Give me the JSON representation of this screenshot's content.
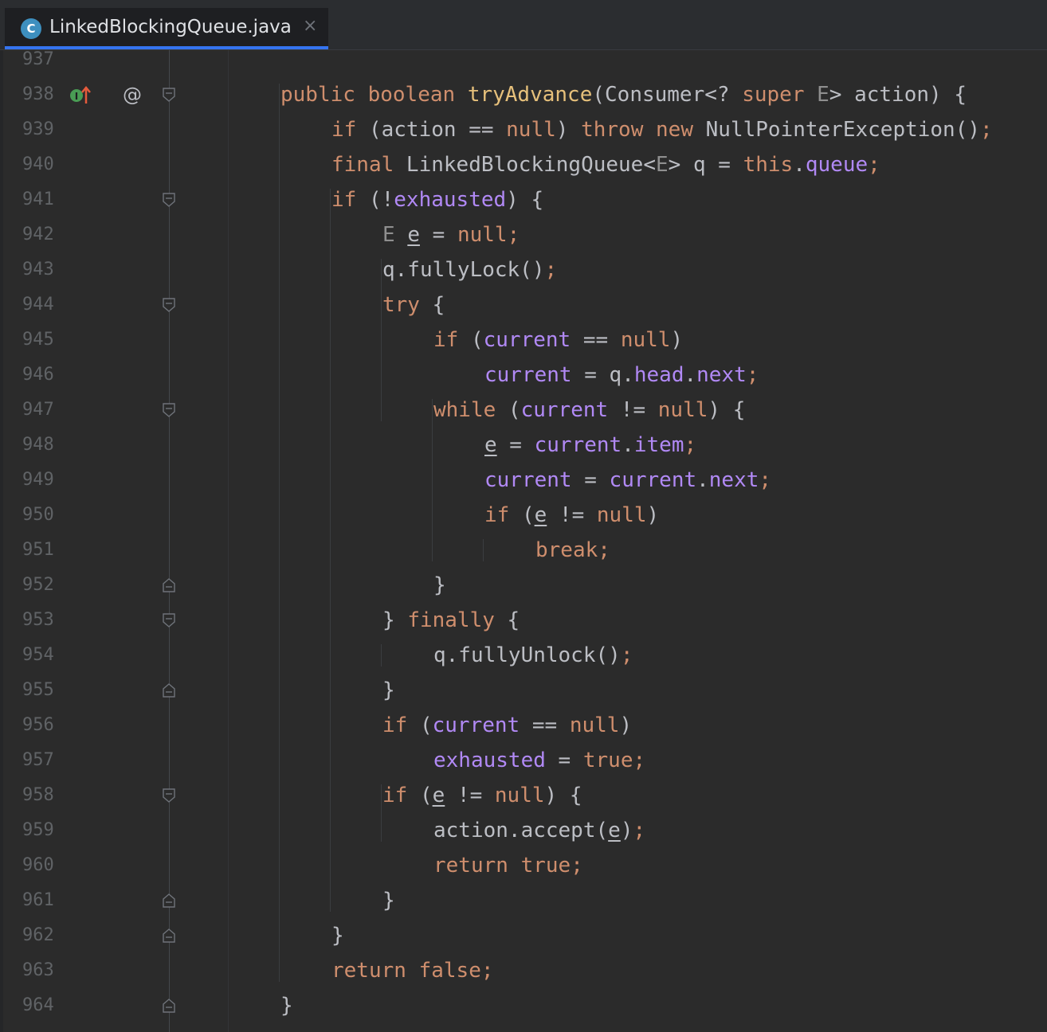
{
  "tab": {
    "icon_letter": "C",
    "filename": "LinkedBlockingQueue.java",
    "close_glyph": "×",
    "accent_color": "#3574f0"
  },
  "gutter": {
    "impl_icon": "implements-method-icon",
    "annotation_glyph": "@",
    "fold_icons": "fold-marker-icon"
  },
  "colors": {
    "keyword": "#cf8e6d",
    "method": "#e6c07b",
    "field": "#b189f5",
    "type_param": "#8f8f8f",
    "text": "#bcbec4",
    "line_number": "#606366",
    "background": "#2b2b2b"
  },
  "lines": [
    {
      "n": "937",
      "indent": 0,
      "fold": "",
      "tokens": []
    },
    {
      "n": "938",
      "indent": 1,
      "fold": "open",
      "tokens": [
        {
          "t": "public ",
          "c": "kw"
        },
        {
          "t": "boolean ",
          "c": "kw"
        },
        {
          "t": "tryAdvance",
          "c": "fn"
        },
        {
          "t": "(Consumer<? ",
          "c": "p"
        },
        {
          "t": "super ",
          "c": "kw"
        },
        {
          "t": "E",
          "c": "tp"
        },
        {
          "t": "> action) {",
          "c": "p"
        }
      ]
    },
    {
      "n": "939",
      "indent": 2,
      "fold": "",
      "tokens": [
        {
          "t": "if ",
          "c": "kw"
        },
        {
          "t": "(action == ",
          "c": "p"
        },
        {
          "t": "null",
          "c": "kw"
        },
        {
          "t": ") ",
          "c": "p"
        },
        {
          "t": "throw ",
          "c": "kw"
        },
        {
          "t": "new ",
          "c": "kw"
        },
        {
          "t": "NullPointerException()",
          "c": "p"
        },
        {
          "t": ";",
          "c": "kw"
        }
      ]
    },
    {
      "n": "940",
      "indent": 2,
      "fold": "",
      "tokens": [
        {
          "t": "final ",
          "c": "kw"
        },
        {
          "t": "LinkedBlockingQueue<",
          "c": "p"
        },
        {
          "t": "E",
          "c": "tp"
        },
        {
          "t": "> q = ",
          "c": "p"
        },
        {
          "t": "this",
          "c": "kw"
        },
        {
          "t": ".",
          "c": "p"
        },
        {
          "t": "queue",
          "c": "fld"
        },
        {
          "t": ";",
          "c": "kw"
        }
      ]
    },
    {
      "n": "941",
      "indent": 2,
      "fold": "open",
      "tokens": [
        {
          "t": "if ",
          "c": "kw"
        },
        {
          "t": "(!",
          "c": "p"
        },
        {
          "t": "exhausted",
          "c": "fld"
        },
        {
          "t": ") {",
          "c": "p"
        }
      ]
    },
    {
      "n": "942",
      "indent": 3,
      "fold": "",
      "tokens": [
        {
          "t": "E ",
          "c": "tp"
        },
        {
          "t": "e",
          "c": "p",
          "u": true
        },
        {
          "t": " = ",
          "c": "p"
        },
        {
          "t": "null",
          "c": "kw"
        },
        {
          "t": ";",
          "c": "kw"
        }
      ]
    },
    {
      "n": "943",
      "indent": 3,
      "fold": "",
      "tokens": [
        {
          "t": "q.fullyLock()",
          "c": "p"
        },
        {
          "t": ";",
          "c": "kw"
        }
      ]
    },
    {
      "n": "944",
      "indent": 3,
      "fold": "open",
      "tokens": [
        {
          "t": "try ",
          "c": "kw"
        },
        {
          "t": "{",
          "c": "p"
        }
      ]
    },
    {
      "n": "945",
      "indent": 4,
      "fold": "",
      "tokens": [
        {
          "t": "if ",
          "c": "kw"
        },
        {
          "t": "(",
          "c": "p"
        },
        {
          "t": "current",
          "c": "fld"
        },
        {
          "t": " == ",
          "c": "p"
        },
        {
          "t": "null",
          "c": "kw"
        },
        {
          "t": ")",
          "c": "p"
        }
      ]
    },
    {
      "n": "946",
      "indent": 5,
      "fold": "",
      "tokens": [
        {
          "t": "current",
          "c": "fld"
        },
        {
          "t": " = q.",
          "c": "p"
        },
        {
          "t": "head",
          "c": "fld"
        },
        {
          "t": ".",
          "c": "p"
        },
        {
          "t": "next",
          "c": "fld"
        },
        {
          "t": ";",
          "c": "kw"
        }
      ]
    },
    {
      "n": "947",
      "indent": 4,
      "fold": "open",
      "tokens": [
        {
          "t": "while ",
          "c": "kw"
        },
        {
          "t": "(",
          "c": "p"
        },
        {
          "t": "current",
          "c": "fld"
        },
        {
          "t": " != ",
          "c": "p"
        },
        {
          "t": "null",
          "c": "kw"
        },
        {
          "t": ") {",
          "c": "p"
        }
      ]
    },
    {
      "n": "948",
      "indent": 5,
      "fold": "",
      "tokens": [
        {
          "t": "e",
          "c": "p",
          "u": true
        },
        {
          "t": " = ",
          "c": "p"
        },
        {
          "t": "current",
          "c": "fld"
        },
        {
          "t": ".",
          "c": "p"
        },
        {
          "t": "item",
          "c": "fld"
        },
        {
          "t": ";",
          "c": "kw"
        }
      ]
    },
    {
      "n": "949",
      "indent": 5,
      "fold": "",
      "tokens": [
        {
          "t": "current",
          "c": "fld"
        },
        {
          "t": " = ",
          "c": "p"
        },
        {
          "t": "current",
          "c": "fld"
        },
        {
          "t": ".",
          "c": "p"
        },
        {
          "t": "next",
          "c": "fld"
        },
        {
          "t": ";",
          "c": "kw"
        }
      ]
    },
    {
      "n": "950",
      "indent": 5,
      "fold": "",
      "tokens": [
        {
          "t": "if ",
          "c": "kw"
        },
        {
          "t": "(",
          "c": "p"
        },
        {
          "t": "e",
          "c": "p",
          "u": true
        },
        {
          "t": " != ",
          "c": "p"
        },
        {
          "t": "null",
          "c": "kw"
        },
        {
          "t": ")",
          "c": "p"
        }
      ]
    },
    {
      "n": "951",
      "indent": 6,
      "fold": "",
      "tokens": [
        {
          "t": "break",
          "c": "kw"
        },
        {
          "t": ";",
          "c": "kw"
        }
      ]
    },
    {
      "n": "952",
      "indent": 4,
      "fold": "close",
      "tokens": [
        {
          "t": "}",
          "c": "p"
        }
      ]
    },
    {
      "n": "953",
      "indent": 3,
      "fold": "open",
      "tokens": [
        {
          "t": "} ",
          "c": "p"
        },
        {
          "t": "finally ",
          "c": "kw"
        },
        {
          "t": "{",
          "c": "p"
        }
      ]
    },
    {
      "n": "954",
      "indent": 4,
      "fold": "",
      "tokens": [
        {
          "t": "q.fullyUnlock()",
          "c": "p"
        },
        {
          "t": ";",
          "c": "kw"
        }
      ]
    },
    {
      "n": "955",
      "indent": 3,
      "fold": "close",
      "tokens": [
        {
          "t": "}",
          "c": "p"
        }
      ]
    },
    {
      "n": "956",
      "indent": 3,
      "fold": "",
      "tokens": [
        {
          "t": "if ",
          "c": "kw"
        },
        {
          "t": "(",
          "c": "p"
        },
        {
          "t": "current",
          "c": "fld"
        },
        {
          "t": " == ",
          "c": "p"
        },
        {
          "t": "null",
          "c": "kw"
        },
        {
          "t": ")",
          "c": "p"
        }
      ]
    },
    {
      "n": "957",
      "indent": 4,
      "fold": "",
      "tokens": [
        {
          "t": "exhausted",
          "c": "fld"
        },
        {
          "t": " = ",
          "c": "p"
        },
        {
          "t": "true",
          "c": "kw"
        },
        {
          "t": ";",
          "c": "kw"
        }
      ]
    },
    {
      "n": "958",
      "indent": 3,
      "fold": "open",
      "tokens": [
        {
          "t": "if ",
          "c": "kw"
        },
        {
          "t": "(",
          "c": "p"
        },
        {
          "t": "e",
          "c": "p",
          "u": true
        },
        {
          "t": " != ",
          "c": "p"
        },
        {
          "t": "null",
          "c": "kw"
        },
        {
          "t": ") {",
          "c": "p"
        }
      ]
    },
    {
      "n": "959",
      "indent": 4,
      "fold": "",
      "tokens": [
        {
          "t": "action.accept(",
          "c": "p"
        },
        {
          "t": "e",
          "c": "p",
          "u": true
        },
        {
          "t": ")",
          "c": "p"
        },
        {
          "t": ";",
          "c": "kw"
        }
      ]
    },
    {
      "n": "960",
      "indent": 4,
      "fold": "",
      "tokens": [
        {
          "t": "return ",
          "c": "kw"
        },
        {
          "t": "true",
          "c": "kw"
        },
        {
          "t": ";",
          "c": "kw"
        }
      ]
    },
    {
      "n": "961",
      "indent": 3,
      "fold": "close",
      "tokens": [
        {
          "t": "}",
          "c": "p"
        }
      ]
    },
    {
      "n": "962",
      "indent": 2,
      "fold": "close",
      "tokens": [
        {
          "t": "}",
          "c": "p"
        }
      ]
    },
    {
      "n": "963",
      "indent": 2,
      "fold": "",
      "tokens": [
        {
          "t": "return ",
          "c": "kw"
        },
        {
          "t": "false",
          "c": "kw"
        },
        {
          "t": ";",
          "c": "kw"
        }
      ]
    },
    {
      "n": "964",
      "indent": 1,
      "fold": "close",
      "tokens": [
        {
          "t": "}",
          "c": "p"
        }
      ]
    }
  ]
}
